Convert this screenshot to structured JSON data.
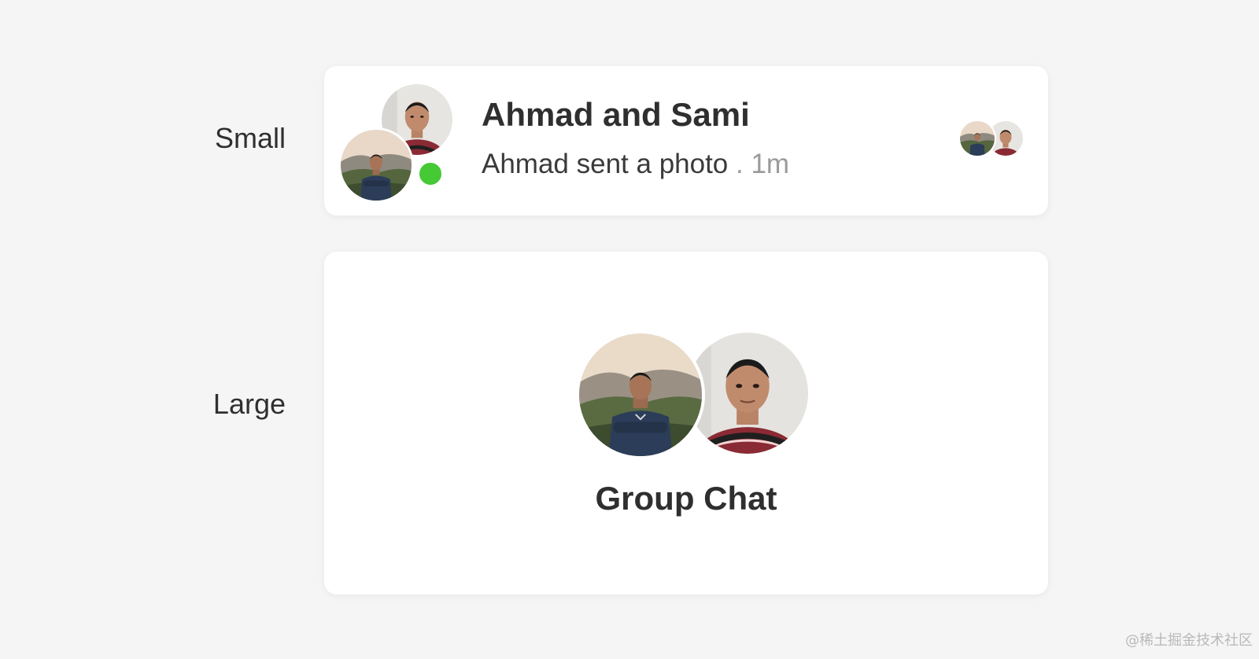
{
  "labels": {
    "small": "Small",
    "large": "Large"
  },
  "small_card": {
    "title": "Ahmad and Sami",
    "message": "Ahmad sent a photo",
    "time_separator": " . ",
    "time": "1m",
    "online": true,
    "online_color": "#45c934"
  },
  "large_card": {
    "title": "Group Chat"
  },
  "watermark": "@稀土掘金技术社区",
  "colors": {
    "background": "#f5f5f5",
    "card": "#ffffff",
    "online": "#45c934",
    "muted_text": "#9a9a9a"
  }
}
